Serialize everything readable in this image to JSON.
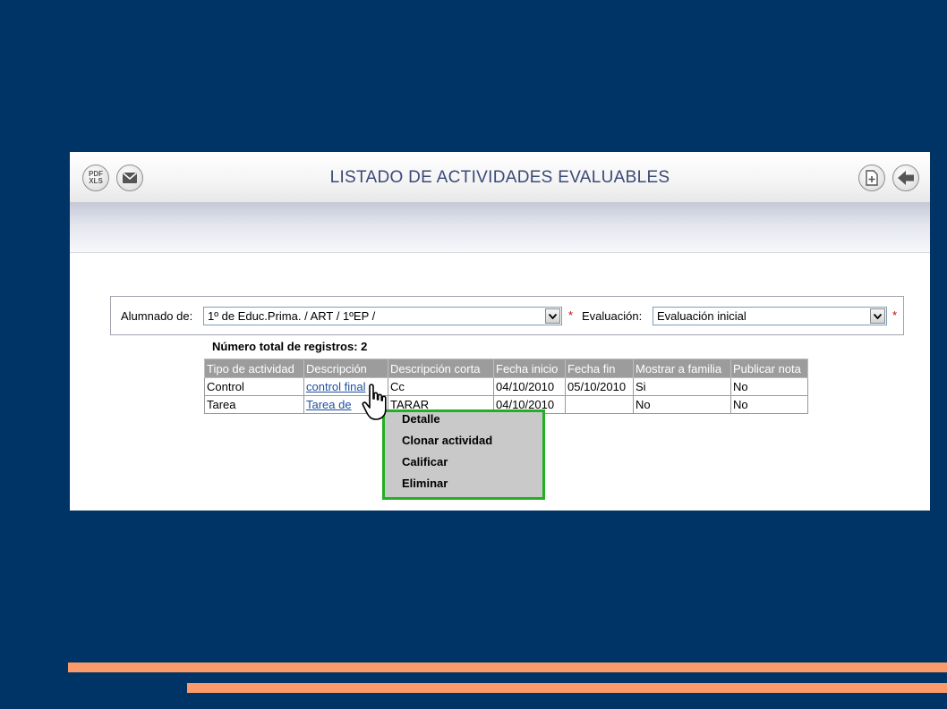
{
  "toolbar": {
    "title": "LISTADO DE ACTIVIDADES EVALUABLES",
    "export_icon_text": "PDF XLS",
    "icons": [
      "pdf-xls-export-icon",
      "mail-icon",
      "new-document-icon",
      "back-arrow-icon"
    ]
  },
  "filters": {
    "alumnado_label": "Alumnado de:",
    "alumnado_value": "1º de Educ.Prima. / ART / 1ºEP /",
    "evaluacion_label": "Evaluación:",
    "evaluacion_value": "Evaluación inicial",
    "required_mark": "*"
  },
  "records": {
    "count_text": "Número total de registros: 2"
  },
  "table": {
    "headers": [
      "Tipo de actividad",
      "Descripción",
      "Descripción corta",
      "Fecha inicio",
      "Fecha fin",
      "Mostrar a familia",
      "Publicar nota"
    ],
    "rows": [
      [
        "Control",
        "control final",
        "Cc",
        "04/10/2010",
        "05/10/2010",
        "Si",
        "No"
      ],
      [
        "Tarea",
        "Tarea de",
        "TARAR",
        "04/10/2010",
        "",
        "No",
        "No"
      ]
    ]
  },
  "context_menu": {
    "items": [
      "Detalle",
      "Clonar actividad",
      "Calificar",
      "Eliminar"
    ]
  },
  "colors": {
    "slide_background": "#003466",
    "accent_stripe": "#fb9a6b",
    "menu_highlight": "#22b022",
    "header_gray": "#9c9c9c",
    "title_color": "#3a4a78"
  }
}
